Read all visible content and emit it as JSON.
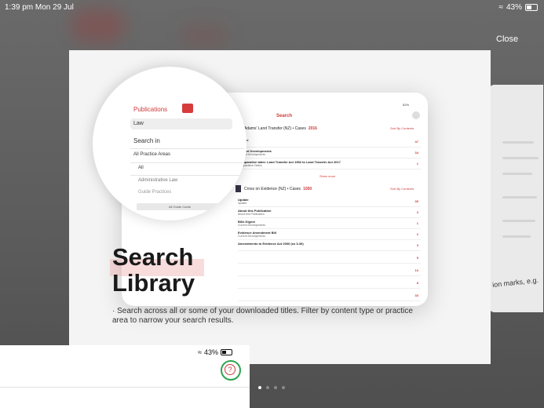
{
  "status_bar": {
    "time": "1:39 pm  Mon 29 Jul",
    "battery": "43%"
  },
  "overlay": {
    "close_label": "Close"
  },
  "slide": {
    "title": "Search\nLibrary",
    "description": "· Search across all or some of your downloaded titles. Filter by content type or practice area to narrow your search results.",
    "side_text": "ion marks, e.g."
  },
  "tablet": {
    "search_title": "Search",
    "battery": "52%",
    "books": [
      {
        "title": "Adams' Land Transfer (NZ) • Cases",
        "count": "2016",
        "sort": "Sort By Contents"
      },
      {
        "title": "Cross on Evidence (NZ) • Cases",
        "count": "1050",
        "sort": "Sort By Contents"
      }
    ],
    "rows_a": [
      {
        "t": "Update",
        "s": "Update",
        "n": "47"
      },
      {
        "t": "Current Developments",
        "s": "Current Developments",
        "n": "34"
      },
      {
        "t": "Comparative table: Land Transfer Act 1952 to Land Transfer Act 2017",
        "s": "Comparative Tables",
        "n": "1"
      }
    ],
    "show_more": "Show more",
    "rows_b": [
      {
        "t": "Update",
        "s": "Update",
        "n": "39"
      },
      {
        "t": "About this Publication",
        "s": "About this Publication",
        "n": "3"
      },
      {
        "t": "Bills Digest",
        "s": "Current Developments",
        "n": "1"
      },
      {
        "t": "Evidence Amendment Bill",
        "s": "Current Developments",
        "n": "2"
      },
      {
        "t": "Amendments to Evidence Act 2006 (ss 3-30)",
        "s": "",
        "n": "3"
      },
      {
        "t": "",
        "s": "",
        "n": "5"
      },
      {
        "t": "",
        "s": "",
        "n": "10"
      },
      {
        "t": "",
        "s": "",
        "n": "8"
      },
      {
        "t": "",
        "s": "",
        "n": "33"
      }
    ]
  },
  "magnifier": {
    "top_label": "Publications",
    "search_value": "Law",
    "search_in": "Search in",
    "options": [
      "All Practice Areas",
      "All",
      "Administrative Law",
      "Guide Practices"
    ],
    "button": "All Guide Cards"
  },
  "bottom_panel": {
    "battery": "43%",
    "help_symbol": "?"
  },
  "pager": {
    "count": 4,
    "active": 0
  },
  "colors": {
    "accent": "#d03a3a",
    "focus_ring": "#2ea44f"
  }
}
